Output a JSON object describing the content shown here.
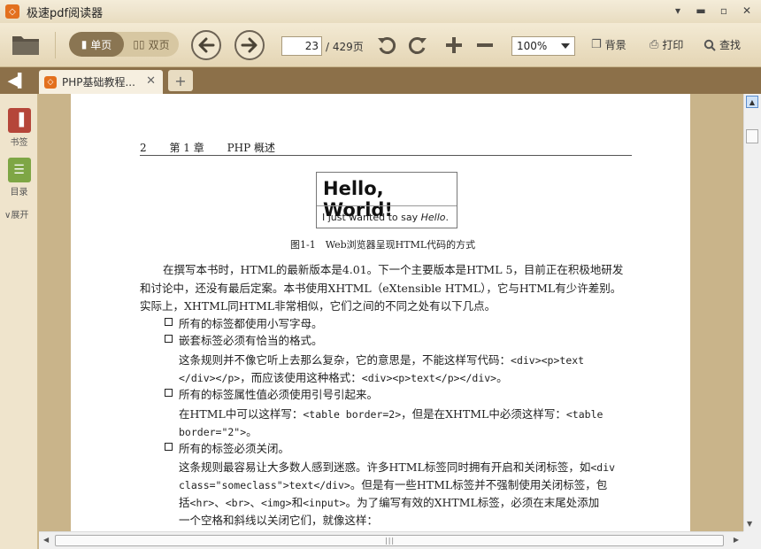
{
  "app": {
    "title": "极速pdf阅读器",
    "logo_glyph": "◇",
    "accent": "#e3701e"
  },
  "window_controls": {
    "menu_icon": "▾",
    "minimize_icon": "▬",
    "maximize_icon": "▫",
    "close_icon": "✕"
  },
  "toolbar": {
    "single_page_label": "单页",
    "double_page_label": "双页",
    "page_current": "23",
    "page_total": "/ 429页",
    "zoom_value": "100%",
    "background_label": "背景",
    "print_label": "打印",
    "search_label": "查找"
  },
  "tabs": [
    {
      "label": "PHP基础教程..."
    }
  ],
  "sidepanel": {
    "bookmarks_label": "书签",
    "toc_label": "目录",
    "expand_label": "展开"
  },
  "document": {
    "header_page_number": "2",
    "header_chapter": "第 1 章",
    "header_title": "PHP 概述",
    "figure_title": "Hello, World!",
    "figure_subtitle_prefix": "I just wanted to say ",
    "figure_subtitle_em": "Hello",
    "figure_subtitle_suffix": ".",
    "figure_caption": "图1-1　Web浏览器呈现HTML代码的方式",
    "paragraph_lines": [
      "在撰写本书时，HTML的最新版本是4.01。下一个主要版本是HTML 5，目前正在积极地研发",
      "和讨论中，还没有最后定案。本书使用XHTML（eXtensible HTML），它与HTML有少许差别。",
      "实际上，XHTML同HTML非常相似，它们之间的不同之处有以下几点。"
    ],
    "bullets": [
      {
        "text": "所有的标签都使用小写字母。",
        "sub": []
      },
      {
        "text": "嵌套标签必须有恰当的格式。",
        "sub": [
          {
            "pre": "这条规则并不像它听上去那么复杂，它的意思是，不能这样写代码：",
            "code": "<div><p>text"
          },
          {
            "pre": "",
            "code": "</div></p>",
            "post": "，而应该使用这种格式：",
            "code2": "<div><p>text</p></div>",
            "post2": "。"
          }
        ]
      },
      {
        "text": "所有的标签属性值必须使用引号引起来。",
        "sub": [
          {
            "pre": "在HTML中可以这样写：",
            "code": "<table border=2>",
            "post": "，但是在XHTML中必须这样写：",
            "code2": "<table"
          },
          {
            "pre": "",
            "code": "border=\"2\">",
            "post": "。"
          }
        ]
      },
      {
        "text": "所有的标签必须关闭。",
        "sub": [
          {
            "pre": "这条规则最容易让大多数人感到迷惑。许多HTML标签同时拥有开启和关闭标签，如",
            "code": "<div"
          },
          {
            "pre": "",
            "code": "class=\"someclass\">text</div>",
            "post": "。但是有一些HTML标签并不强制使用关闭标签，包"
          },
          {
            "pre": "括",
            "code": "<hr>",
            "post": "、",
            "code2": "<br>",
            "post2": "、",
            "code3": "<img>",
            "post3": "和",
            "code4": "<input>",
            "post4": "。为了编写有效的XHTML标签，必须在末尾处添加"
          },
          {
            "pre": "一个空格和斜线以关闭它们，就像这样："
          }
        ]
      }
    ]
  }
}
